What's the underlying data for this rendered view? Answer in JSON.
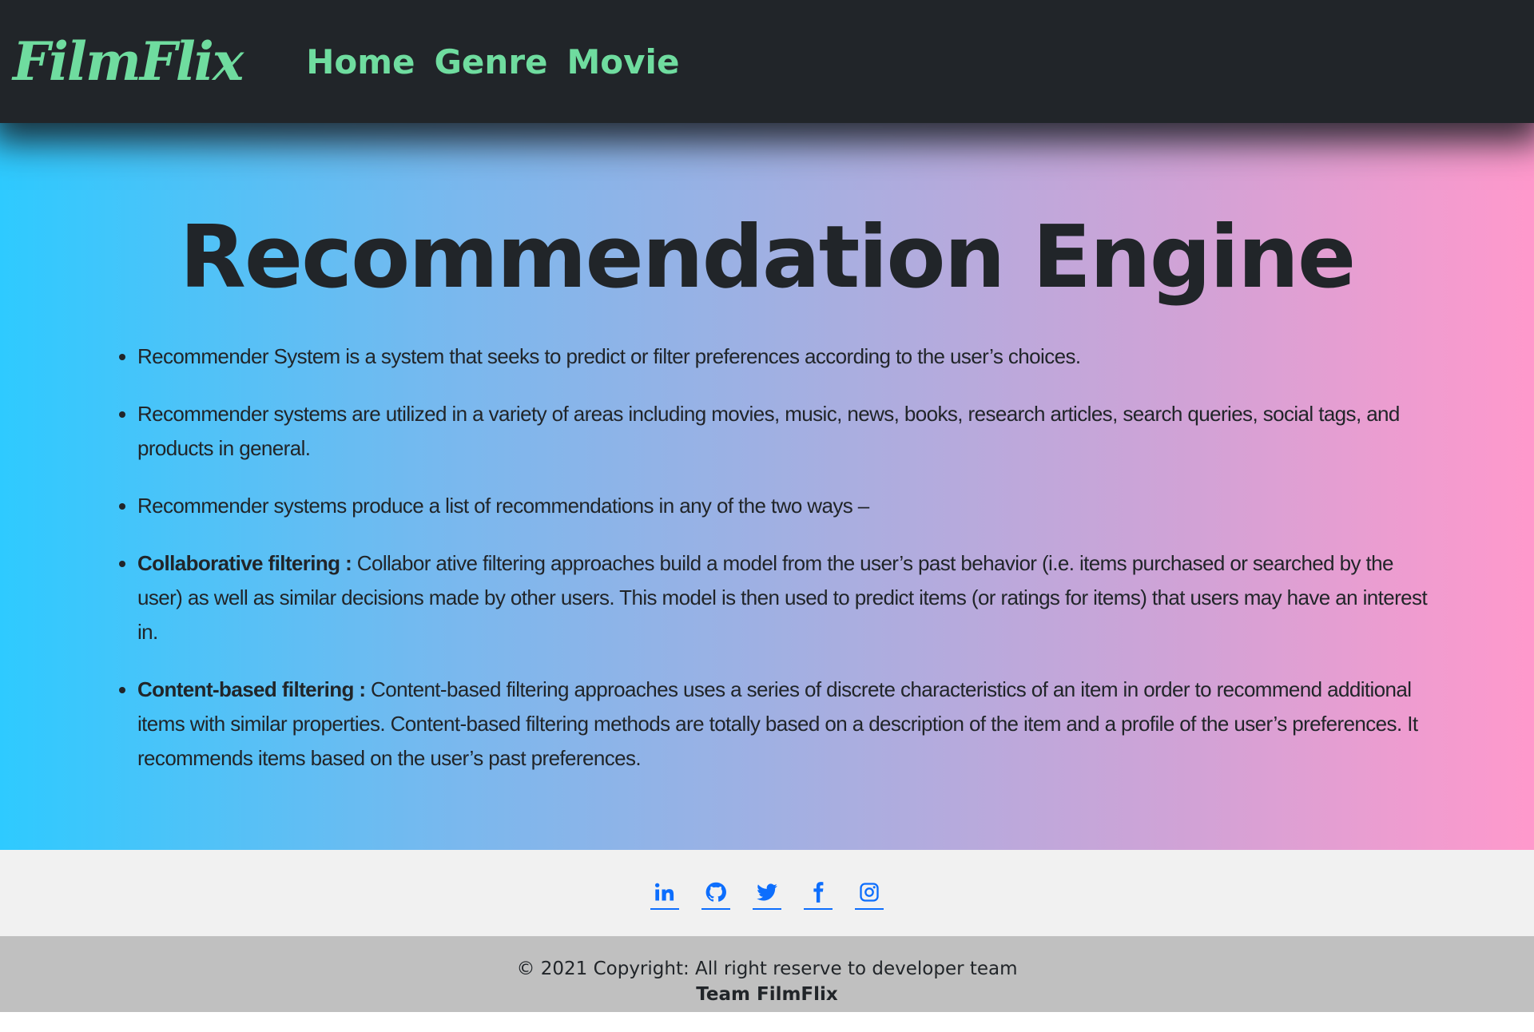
{
  "navbar": {
    "brand": "FilmFlix",
    "links": [
      "Home",
      "Genre",
      "Movie"
    ]
  },
  "main": {
    "title": "Recommendation Engine",
    "items": [
      {
        "bold": "",
        "text": "Recommender System is a system that seeks to predict or filter preferences according to the user’s choices."
      },
      {
        "bold": "",
        "text": "Recommender systems are utilized in a variety of areas including movies, music, news, books, research articles, search queries, social tags, and products in general."
      },
      {
        "bold": "",
        "text": "Recommender systems produce a list of recommendations in any of the two ways –"
      },
      {
        "bold": "Collaborative filtering :",
        "text": " Collabor ative filtering approaches build a model from the user’s past behavior (i.e. items purchased or searched by the user) as well as similar decisions made by other users. This model is then used to predict items (or ratings for items) that users may have an interest in."
      },
      {
        "bold": "Content-based filtering :",
        "text": " Content-based filtering approaches uses a series of discrete characteristics of an item in order to recommend additional items with similar properties. Content-based filtering methods are totally based on a description of the item and a profile of the user’s preferences. It recommends items based on the user’s past preferences."
      }
    ]
  },
  "footer": {
    "social_icons": [
      "linkedin-icon",
      "github-icon",
      "twitter-icon",
      "facebook-icon",
      "instagram-icon"
    ],
    "copyright": "© 2021 Copyright: All right reserve to developer team",
    "team": "Team FilmFlix"
  },
  "colors": {
    "nav_bg": "#212529",
    "accent_green": "#6fdc9f",
    "gradient_left": "#2ecaff",
    "gradient_right": "#ff99cc",
    "link_blue": "#0d6efd"
  }
}
